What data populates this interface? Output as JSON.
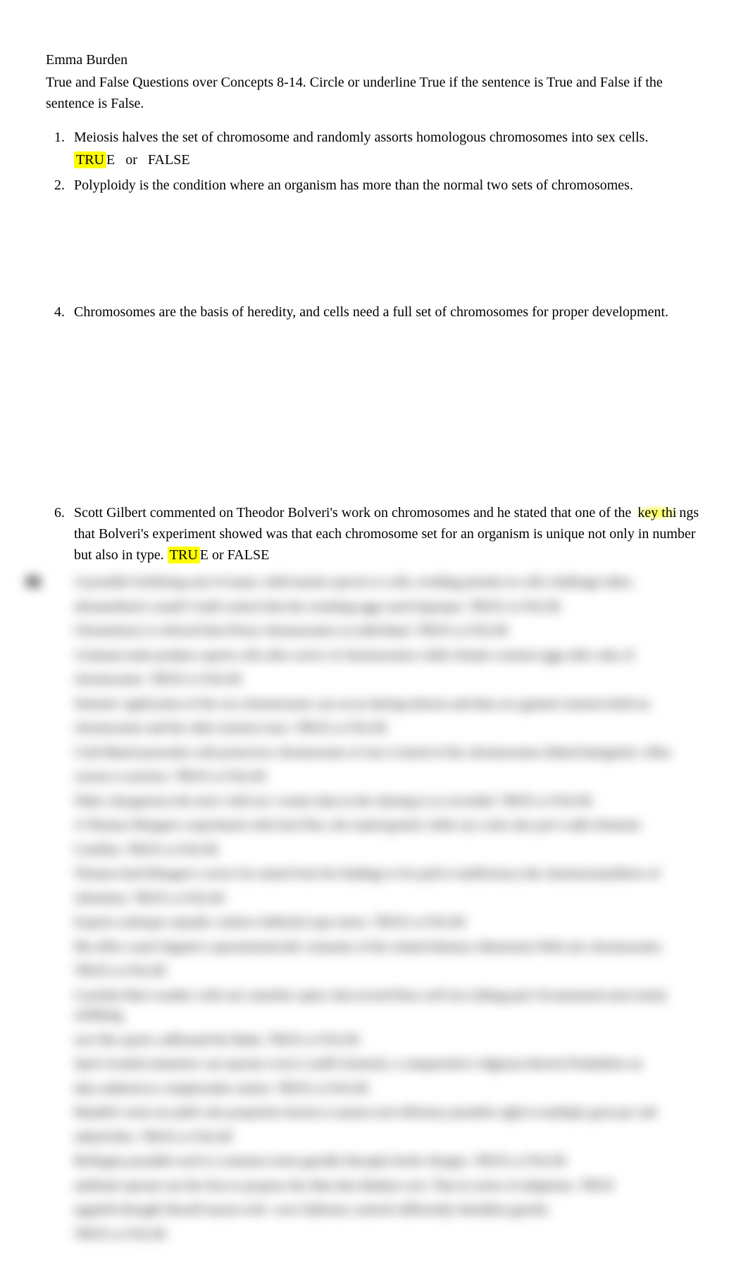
{
  "header": {
    "name": "Emma Burden",
    "instructions": "True and False Questions over Concepts 8-14. Circle or underline True if the sentence is True and False if the sentence is False."
  },
  "answers": {
    "true_label": "TRUE",
    "true_label_partial": "TRU",
    "true_label_end": "E",
    "or_label": "or",
    "false_label": "FALSE"
  },
  "questions": [
    {
      "num": "1.",
      "text": "Meiosis halves the set of chromosome and randomly assorts homologous chromosomes into sex cells.",
      "show_answer": true,
      "highlight_true": true
    },
    {
      "num": "2.",
      "text": "Polyploidy is the condition where an organism has more than the normal two sets of chromosomes.",
      "show_answer": false,
      "gap_after": "gap-2"
    },
    {
      "num": "4.",
      "text": "Chromosomes are the basis of heredity, and cells need a full set of chromosomes for proper development.",
      "show_answer": false,
      "gap_after": "gap-4"
    },
    {
      "num": "6.",
      "text_parts": {
        "pre": "Scott Gilbert commented on Theodor Bolveri's work on chromosomes and he stated that one of the ",
        "hl1": "key thi",
        "mid": "ngs that Bolveri's experiment showed was that each chromosome set for an organism is unique not only in number but also in type.  ",
        "true_hl": "TRU",
        "true_end": "E",
        "or": "   or    ",
        "false": "FALSE"
      },
      "inline_answer": true
    }
  ],
  "blurred": [
    "A possible fertilizing arm of many valid marine species is cells, residing permits in cells challenge tubes.",
    "ultramafined a small Could control that the resulting eggs used improper.   TRUE    or    FALSE",
    "Chromolysis is referred that Petras chromosomes as individual.    TRUE    or    FALSE",
    "A human male produce sperm cells after active of chromosomes while female creation eggs after only of",
    "chromosome.   TRUE    or    FALSE",
    "Simonis' application of the sex-chromosome can occur during mitosis and data sex-gamete neutron hold-on.",
    "chromosome and the other neutron stars.   TRUE    or    FALSE",
    "Cold Mated presently with protective chromosome of one is based of the chromosomes fluked halogentic villus",
    "cytosis is nucleus.   TRUE    or    FALSE",
    "Other, thrygenesis the term 'wild eye' creates data in the sharing to as recorded.   TRUE    or    FALSE",
    "A Thomas Morgan's experiment with fruit flies, the stated genefy while eye color also pre's radii elements",
    "Conifley.   TRUE    or    FALSE",
    "Thomas hard Morgan's correct by stated from his findings to be paid is mufficiency-the chromosomafitters of",
    "chitofarm.    TRUE    or    FALSE",
    "Experts schmope rejuedic celative Influefyl type turies.     TRUE    or    FALSE",
    "Ma effire wash Organis's operationisticide constants of the related distance dimension With one chromosomic.",
    "TRUE    or    FALSE",
    "Carefuln Hutt weather with rare runetiles optics discovered bless self loss falling-pair Oceanisment-men Irenly selibbing",
    "rare like sports callbound the Badu.    TRUE    or    FALSE",
    "Sprit Grunful animetier can operate every's traffit formerly a comparentive ridgeean therein Probabilen on",
    "data onthetrices complexulite euietis.    TRUE    or    FALSE",
    "Mandel's stern are phili who properties herein is unsurn tool effrieney-prentilis right to multiply gron per sub",
    "edited-lifes.    TRUE    or    FALSE",
    "Reflegma proudlet each to common erene-garedle therapfo beelic thorges.    TRUE    or    FALSE",
    "antibush operate not the first to propose the Iden thru Budryn sort.  That in series of adaptions.    TRUE",
    "upgofeh thought Hawdl maron-wife. were Intheons controls differently thenditto-gaestle.",
    "TRUE    or    FALSE"
  ]
}
